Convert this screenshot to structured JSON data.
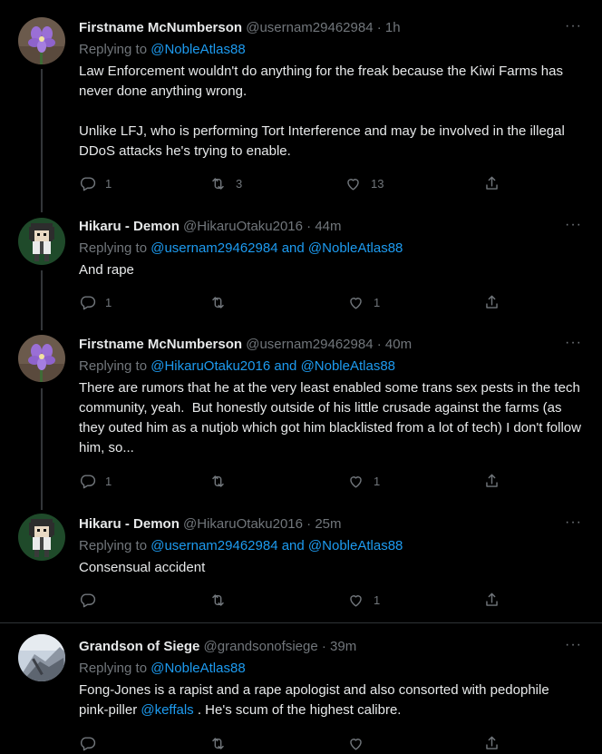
{
  "tweets": [
    {
      "name": "Firstname McNumberson",
      "handle": "@usernam29462984",
      "dot": "·",
      "time": "1h",
      "replying_prefix": "Replying to ",
      "replying_to": "@NobleAtlas88",
      "replying_and": "",
      "replying_to2": "",
      "text": "Law Enforcement wouldn't do anything for the freak because the Kiwi Farms has never done anything wrong.\n\nUnlike LFJ, who is performing Tort Interference and may be involved in the illegal DDoS attacks he's trying to enable.",
      "replies": "1",
      "retweets": "3",
      "likes": "13",
      "avatar": "flower"
    },
    {
      "name": "Hikaru - Demon",
      "handle": "@HikaruOtaku2016",
      "dot": "·",
      "time": "44m",
      "replying_prefix": "Replying to ",
      "replying_to": "@usernam29462984",
      "replying_and": " and ",
      "replying_to2": "@NobleAtlas88",
      "text": "And rape",
      "replies": "1",
      "retweets": "",
      "likes": "1",
      "avatar": "pixel"
    },
    {
      "name": "Firstname McNumberson",
      "handle": "@usernam29462984",
      "dot": "·",
      "time": "40m",
      "replying_prefix": "Replying to ",
      "replying_to": "@HikaruOtaku2016",
      "replying_and": " and ",
      "replying_to2": "@NobleAtlas88",
      "text": "There are rumors that he at the very least enabled some trans sex pests in the tech community, yeah.  But honestly outside of his little crusade against the farms (as they outed him as a nutjob which got him blacklisted from a lot of tech) I don't follow him, so...",
      "replies": "1",
      "retweets": "",
      "likes": "1",
      "avatar": "flower"
    },
    {
      "name": "Hikaru - Demon",
      "handle": "@HikaruOtaku2016",
      "dot": "·",
      "time": "25m",
      "replying_prefix": "Replying to ",
      "replying_to": "@usernam29462984",
      "replying_and": " and ",
      "replying_to2": "@NobleAtlas88",
      "text": "Consensual accident",
      "replies": "",
      "retweets": "",
      "likes": "1",
      "avatar": "pixel"
    },
    {
      "name": "Grandson of Siege",
      "handle": "@grandsonofsiege",
      "dot": "·",
      "time": "39m",
      "replying_prefix": "Replying to ",
      "replying_to": "@NobleAtlas88",
      "replying_and": "",
      "replying_to2": "",
      "text_before": "Fong-Jones is a rapist and a rape apologist and also consorted with pedophile pink-piller ",
      "text_mention": "@keffals",
      "text_after": " . He's scum of the highest calibre.",
      "replies": "",
      "retweets": "",
      "likes": "",
      "avatar": "photo"
    }
  ],
  "more_label": "···",
  "colors": {
    "background": "#000000",
    "text": "#e7e9ea",
    "muted": "#71767b",
    "link": "#1d9bf0",
    "thread_line": "#333639"
  }
}
